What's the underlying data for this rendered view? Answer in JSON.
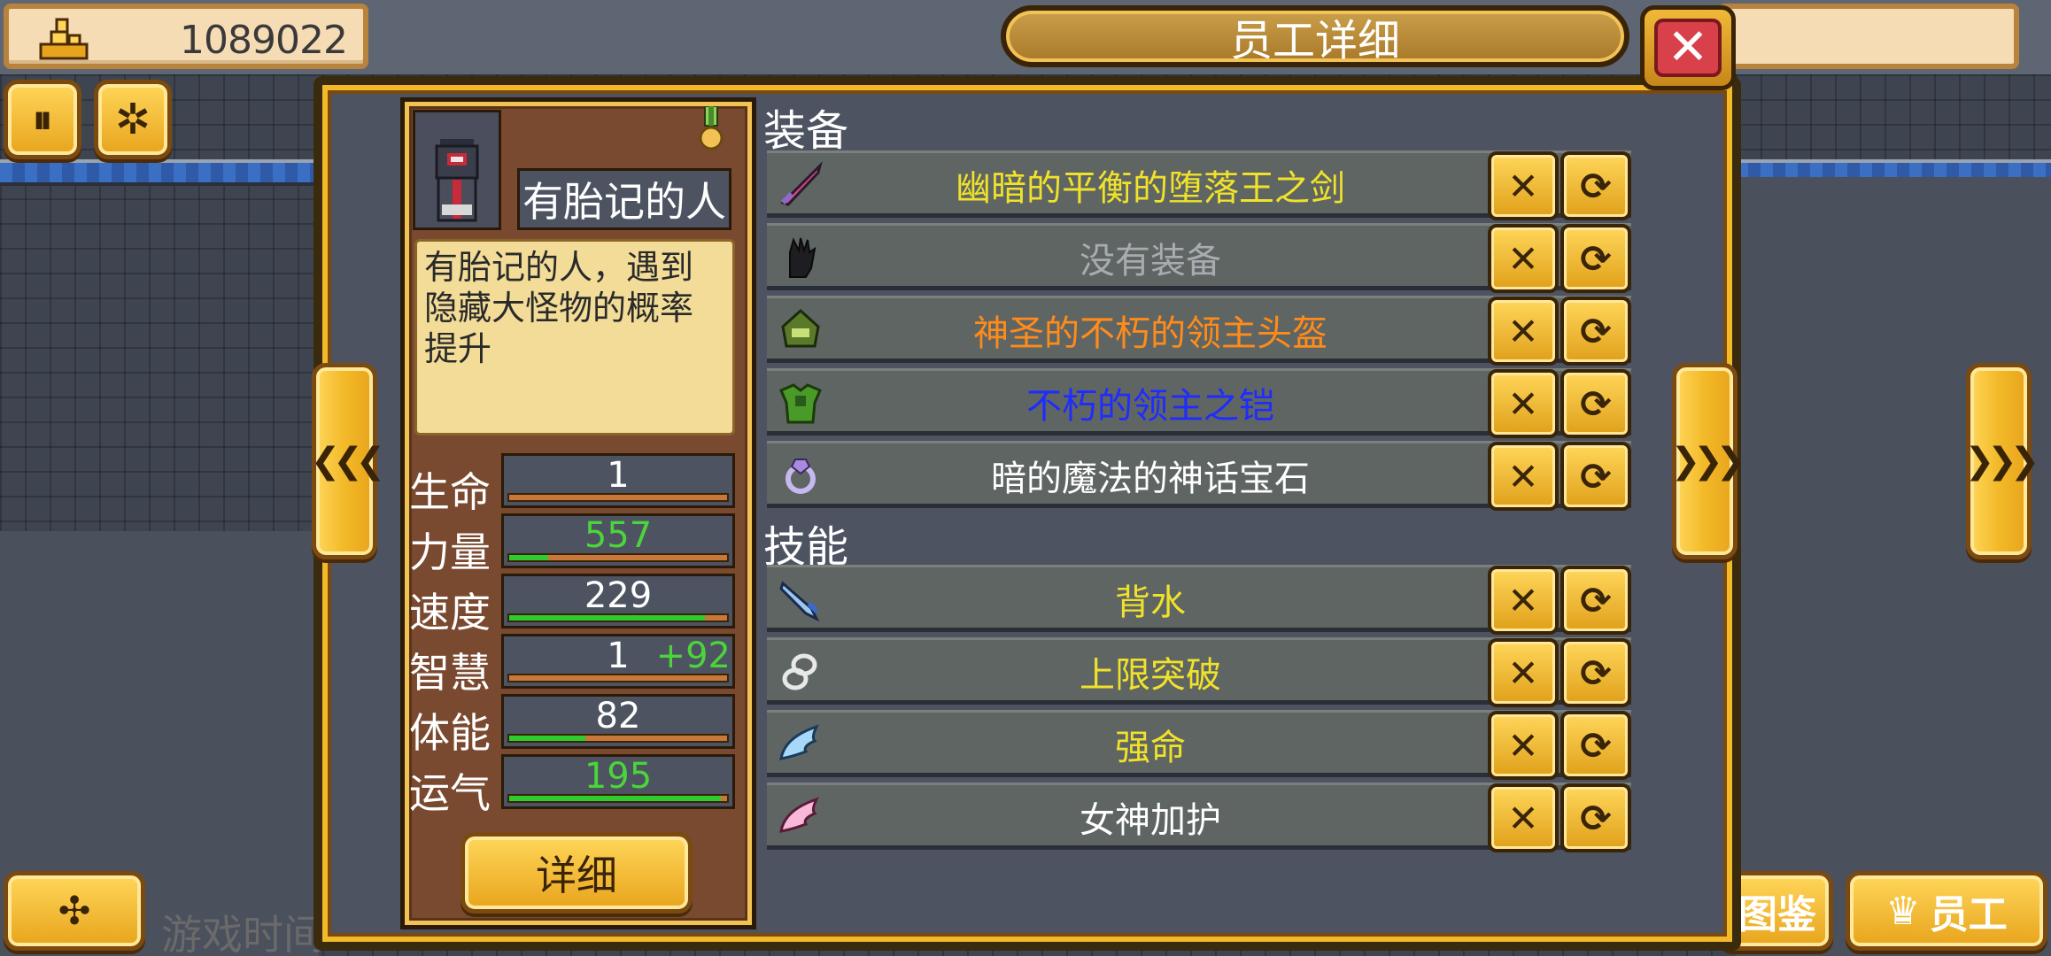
{
  "hud": {
    "money": "1089022",
    "pause_glyph": "⏸",
    "speed_glyph": "✲",
    "game_time_label": "游戏时间",
    "bottom_left_glyph": "✣",
    "codex_label": "图鉴",
    "staff_label": "员工"
  },
  "dialog": {
    "title": "员工详细",
    "close_glyph": "✕",
    "prev_glyph": "❮❮❮",
    "next_glyph": "❯❯❯"
  },
  "employee": {
    "name": "有胎记的人",
    "description": "有胎记的人，遇到隐藏大怪物的概率提升",
    "detail_button": "详细",
    "stats": [
      {
        "label": "生命",
        "value": "1",
        "bonus": "",
        "value_color": "#ffffff",
        "fill": 0.0
      },
      {
        "label": "力量",
        "value": "557",
        "bonus": "",
        "value_color": "#4bd43b",
        "fill": 0.18
      },
      {
        "label": "速度",
        "value": "229",
        "bonus": "",
        "value_color": "#ffffff",
        "fill": 0.9
      },
      {
        "label": "智慧",
        "value": "1",
        "bonus": "+92",
        "value_color": "#ffffff",
        "fill": 0.0
      },
      {
        "label": "体能",
        "value": "82",
        "bonus": "",
        "value_color": "#ffffff",
        "fill": 0.35
      },
      {
        "label": "运气",
        "value": "195",
        "bonus": "",
        "value_color": "#4bd43b",
        "fill": 0.97
      }
    ]
  },
  "equipment": {
    "title": "装备",
    "items": [
      {
        "name": "幽暗的平衡的堕落王之剑",
        "color": "#f0e22a",
        "icon": "sword-icon"
      },
      {
        "name": "没有装备",
        "color": "#a8acb0",
        "icon": "glove-icon"
      },
      {
        "name": "神圣的不朽的领主头盔",
        "color": "#ff8c1a",
        "icon": "helmet-icon"
      },
      {
        "name": "不朽的领主之铠",
        "color": "#1e2cff",
        "icon": "armor-icon"
      },
      {
        "name": "暗的魔法的神话宝石",
        "color": "#ffffff",
        "icon": "gem-icon"
      }
    ]
  },
  "skills": {
    "title": "技能",
    "items": [
      {
        "name": "背水",
        "color": "#f0e22a",
        "icon": "dagger-icon"
      },
      {
        "name": "上限突破",
        "color": "#f0e22a",
        "icon": "chain-icon"
      },
      {
        "name": "强命",
        "color": "#f0e22a",
        "icon": "wing-icon"
      },
      {
        "name": "女神加护",
        "color": "#ffffff",
        "icon": "pink-wing-icon"
      }
    ]
  },
  "row_buttons": {
    "remove_glyph": "✕",
    "swap_glyph": "⟳"
  },
  "colors": {
    "gold": "#f2b928",
    "panel": "#4d5361",
    "card": "#7a4a30"
  }
}
